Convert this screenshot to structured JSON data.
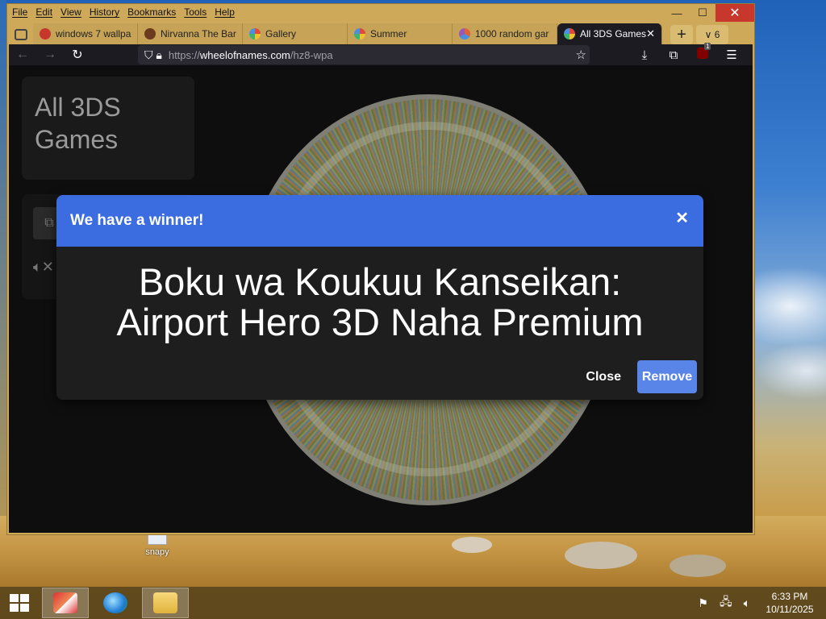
{
  "browser": {
    "menu": [
      "File",
      "Edit",
      "View",
      "History",
      "Bookmarks",
      "Tools",
      "Help"
    ],
    "controls": {
      "minimize": "—",
      "maximize": "☐",
      "close": "✕"
    },
    "tabs": [
      {
        "label": "windows 7 wallpa",
        "favicon_color": "#c8372b"
      },
      {
        "label": "Nirvanna The Bar",
        "favicon_color": "#6b3a1f"
      },
      {
        "label": "Gallery",
        "favicon_color": "#4a8fe0"
      },
      {
        "label": "Summer",
        "favicon_color": "#4a8fe0"
      },
      {
        "label": "1000 random gar",
        "favicon_color": "#e0623a"
      },
      {
        "label": "All 3DS Games",
        "favicon_color": "#4a8fe0",
        "close": "✕"
      }
    ],
    "new_tab": "+",
    "tab_count": "6",
    "url": {
      "prefix": "https://",
      "host": "wheelofnames.com",
      "path": "/hz8-wpa"
    },
    "extension_badge": "1"
  },
  "page": {
    "title_line1": "All 3DS",
    "title_line2": "Games"
  },
  "modal": {
    "header": "We have a winner!",
    "close_x": "✕",
    "winner_line1": "Boku wa Koukuu Kanseikan:",
    "winner_line2": "Airport Hero 3D Naha Premium",
    "close_button": "Close",
    "remove_button": "Remove"
  },
  "desktop": {
    "icon_label": "snapy"
  },
  "taskbar": {
    "time": "6:33 PM",
    "date": "10/11/2025"
  },
  "colors": {
    "accent": "#3b6ce0",
    "remove_button": "#5a85e8",
    "window_frame": "#cfa95a",
    "close_button": "#c8372b"
  }
}
